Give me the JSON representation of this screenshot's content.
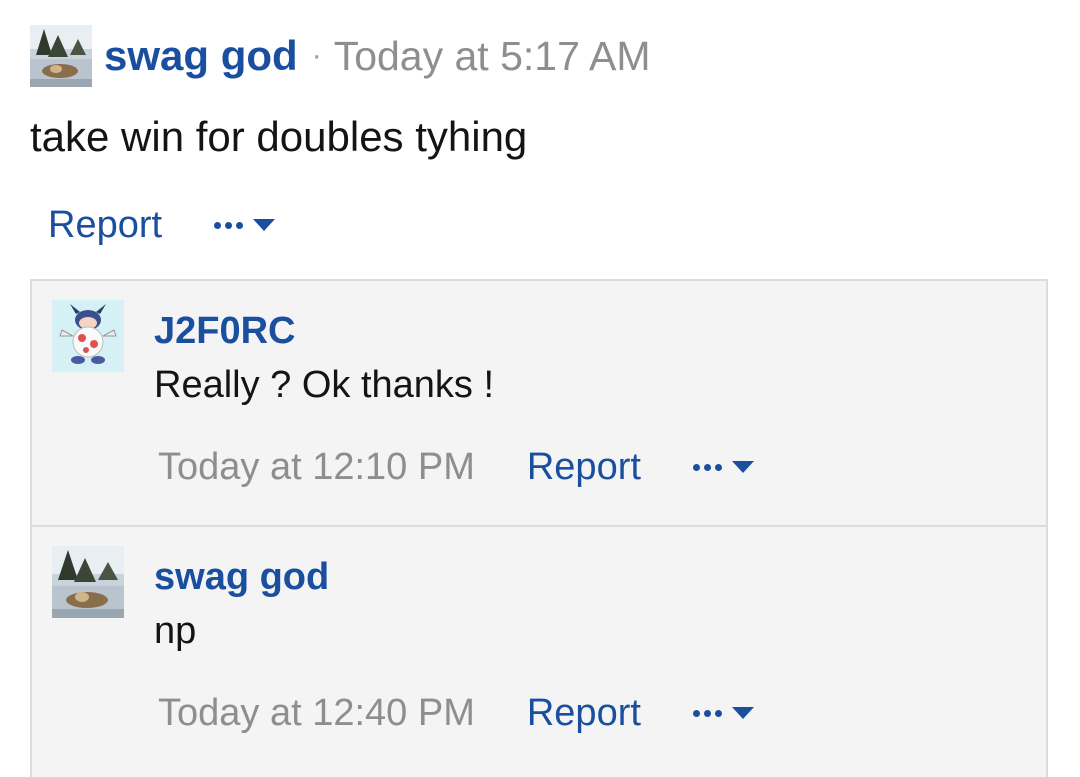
{
  "post": {
    "author": "swag god",
    "separator": "·",
    "time": "Today at 5:17 AM",
    "body": "take win for doubles tyhing",
    "report_label": "Report",
    "more_icon": "ellipsis-dropdown-icon",
    "avatar_icon": "winter-scene-avatar"
  },
  "comments": [
    {
      "author": "J2F0RC",
      "text": "Really ? Ok thanks !",
      "time": "Today at 12:10 PM",
      "report_label": "Report",
      "avatar_icon": "cartoon-character-avatar"
    },
    {
      "author": "swag god",
      "text": "np",
      "time": "Today at 12:40 PM",
      "report_label": "Report",
      "avatar_icon": "winter-scene-avatar"
    }
  ],
  "colors": {
    "link": "#1a4fa0",
    "muted": "#8e8e8e",
    "text": "#141414",
    "comment_bg": "#f4f4f4",
    "border": "#dcdcdc"
  }
}
